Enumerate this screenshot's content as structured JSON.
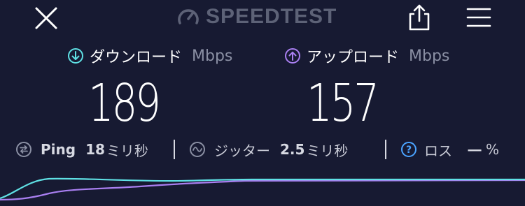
{
  "header": {
    "brand": "SPEEDTEST",
    "icons": {
      "close": "close-icon",
      "brand": "speedometer-icon",
      "share": "share-icon",
      "menu": "menu-icon"
    }
  },
  "download": {
    "label": "ダウンロード",
    "unit": "Mbps",
    "value": "189",
    "color": "#5fe0e4"
  },
  "upload": {
    "label": "アップロード",
    "unit": "Mbps",
    "value": "157",
    "color": "#a97ff1"
  },
  "stats": {
    "ping": {
      "label": "Ping",
      "value": "18",
      "unit": "ミリ秒"
    },
    "jitter": {
      "label": "ジッター",
      "value": "2.5",
      "unit": "ミリ秒"
    },
    "loss": {
      "label": "ロス",
      "value": "一",
      "unit": "%"
    }
  },
  "colors": {
    "background": "#171a32",
    "download": "#5fe0e4",
    "upload": "#a97ff1",
    "loss_icon": "#4aa3ff"
  }
}
